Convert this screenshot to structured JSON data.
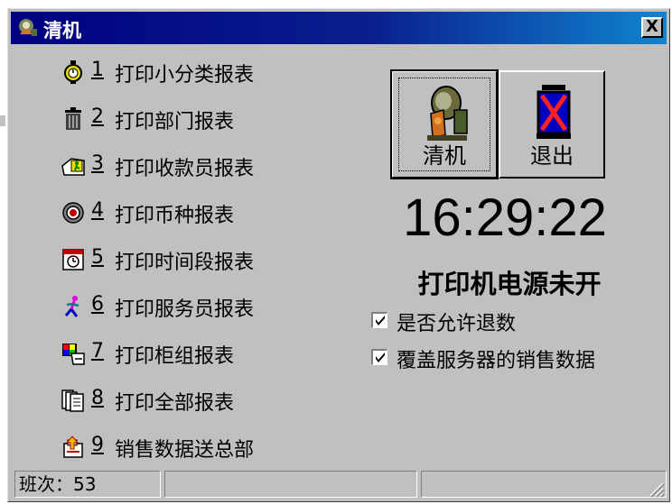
{
  "window": {
    "title": "清机",
    "close_label": "X"
  },
  "menu": [
    {
      "num": "1",
      "label": "打印小分类报表",
      "icon": "stopwatch-icon"
    },
    {
      "num": "2",
      "label": "打印部门报表",
      "icon": "trash-can-icon"
    },
    {
      "num": "3",
      "label": "打印收款员报表",
      "icon": "cashier-icon"
    },
    {
      "num": "4",
      "label": "打印币种报表",
      "icon": "coin-target-icon"
    },
    {
      "num": "5",
      "label": "打印时间段报表",
      "icon": "calendar-clock-icon"
    },
    {
      "num": "6",
      "label": "打印服务员报表",
      "icon": "running-person-icon"
    },
    {
      "num": "7",
      "label": "打印柜组报表",
      "icon": "palette-icon"
    },
    {
      "num": "8",
      "label": "打印全部报表",
      "icon": "documents-icon"
    },
    {
      "num": "9",
      "label": "销售数据送总部",
      "icon": "upload-data-icon"
    }
  ],
  "buttons": {
    "clear": {
      "label": "清机",
      "icon": "sharpener-machine-icon"
    },
    "exit": {
      "label": "退出",
      "icon": "exit-door-icon"
    }
  },
  "clock": "16:29:22",
  "status_message": "打印机电源未开",
  "options": [
    {
      "label": "是否允许退数",
      "checked": true
    },
    {
      "label": "覆盖服务器的销售数据",
      "checked": true
    }
  ],
  "statusbar": {
    "shift_label": "班次：53",
    "panel2": "",
    "panel3": ""
  }
}
